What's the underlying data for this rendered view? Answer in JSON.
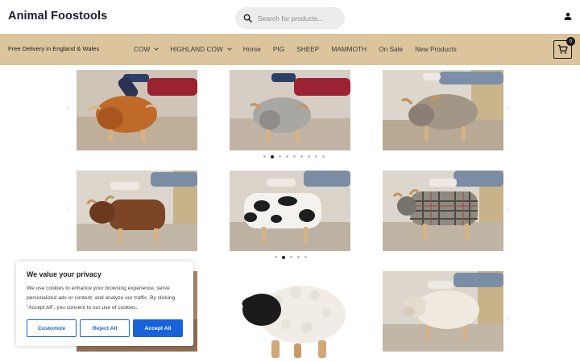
{
  "site": {
    "title": "Animal Foostools"
  },
  "search": {
    "placeholder": "Search for products..."
  },
  "header": {
    "delivery_text": "Free Delivery in England & Wales"
  },
  "menu": {
    "items": [
      {
        "label": "COW",
        "has_dropdown": true
      },
      {
        "label": "HIGHLAND COW",
        "has_dropdown": true
      },
      {
        "label": "Horse",
        "has_dropdown": false
      },
      {
        "label": "PIG",
        "has_dropdown": false
      },
      {
        "label": "SHEEP",
        "has_dropdown": false
      },
      {
        "label": "MAMMOTH",
        "has_dropdown": false
      },
      {
        "label": "On Sale",
        "has_dropdown": false
      },
      {
        "label": "New Products",
        "has_dropdown": false
      }
    ]
  },
  "cart": {
    "count": "0",
    "icon": "cart-icon"
  },
  "products": {
    "row1": [
      "highland-cow-ginger",
      "highland-cow-grey",
      "highland-cow-fawn"
    ],
    "row2": [
      "cow-brown",
      "cow-black-white",
      "highland-cow-tartan"
    ],
    "row3": [
      "hidden-under-banner",
      "sheep-white",
      "sheep-cream"
    ]
  },
  "sliders": {
    "row1": {
      "dot_count": 9,
      "active_index": 1
    },
    "row2": {
      "dot_count": 5,
      "active_index": 1
    }
  },
  "cookie": {
    "title": "We value your privacy",
    "text": "We use cookies to enhance your browsing experience, serve personalized ads or content, and analyze our traffic. By clicking \"Accept All\", you consent to our use of cookies.",
    "customize_label": "Customize",
    "reject_label": "Reject All",
    "accept_label": "Accept All"
  },
  "colors": {
    "nav_bg": "#dcc59d",
    "accent": "#1863dc"
  }
}
